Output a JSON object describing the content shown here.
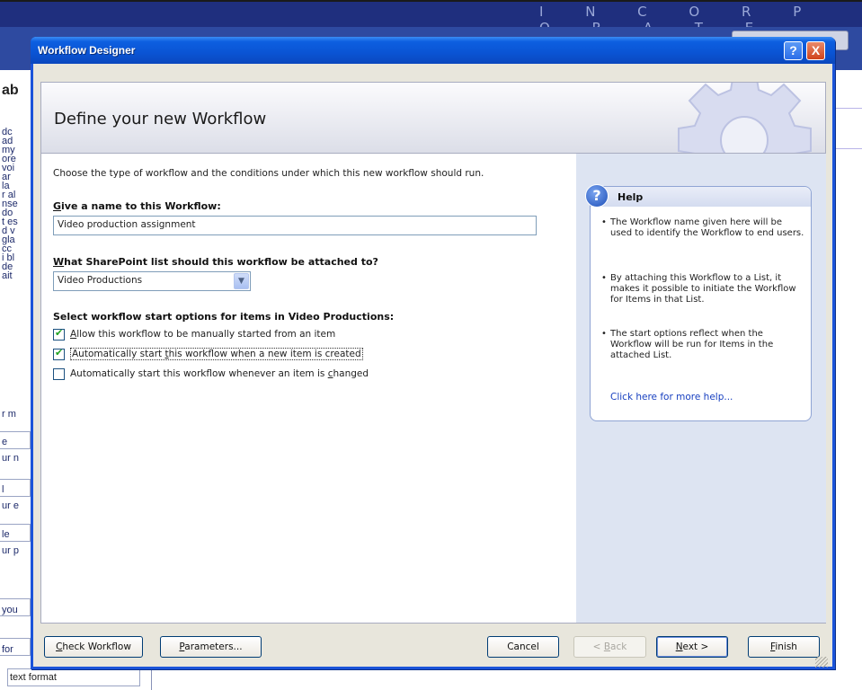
{
  "background": {
    "header_text": "I N C O R P O R A T E",
    "left_fragments": [
      "ab",
      "dc",
      "ad",
      "my",
      "ore",
      "voi",
      "ar",
      "la",
      "r al",
      "nse",
      "do",
      "t es",
      "d v",
      "gla",
      "cc",
      "i bl",
      "de",
      "ait",
      "r m",
      "e",
      "ur n",
      "l",
      "ur e",
      "le",
      "ur p",
      "you",
      "for"
    ],
    "text_format_label": "text format"
  },
  "dialog": {
    "title": "Workflow Designer",
    "help_button": "?",
    "close_button": "X",
    "heading": "Define your new Workflow",
    "intro": "Choose the type of workflow and the conditions under which this new workflow should run.",
    "name_label_accel": "G",
    "name_label_rest": "ive a name to this Workflow:",
    "name_value": "Video production assignment",
    "list_label_accel": "W",
    "list_label_rest": "hat SharePoint list should this workflow be attached to?",
    "list_value": "Video Productions",
    "start_label": "Select workflow start options for items in Video Productions:",
    "options": [
      {
        "accel": "A",
        "rest": "llow this workflow to be manually started from an item",
        "checked": true
      },
      {
        "pre": "Automatically start ",
        "accel": "t",
        "rest": "his workflow when a new item is created",
        "checked": true
      },
      {
        "pre": "Automatically start this workflow whenever an item is ",
        "accel": "c",
        "rest": "hanged",
        "checked": false
      }
    ],
    "help": {
      "title": "Help",
      "bullets": [
        "The Workflow name given here will be used to identify the Workflow to end users.",
        "By attaching this Workflow to a List, it makes it possible to initiate the Workflow for Items in that List.",
        "The start options reflect when the Workflow will be run for Items in the attached List."
      ],
      "link": "Click here for more help..."
    },
    "buttons": {
      "check_accel": "C",
      "check_rest": "heck Workflow",
      "params_accel": "P",
      "params_rest": "arameters...",
      "cancel": "Cancel",
      "back_pre": "< ",
      "back_accel": "B",
      "back_rest": "ack",
      "next_accel": "N",
      "next_rest": "ext >",
      "finish_accel": "F",
      "finish_rest": "inish"
    }
  }
}
